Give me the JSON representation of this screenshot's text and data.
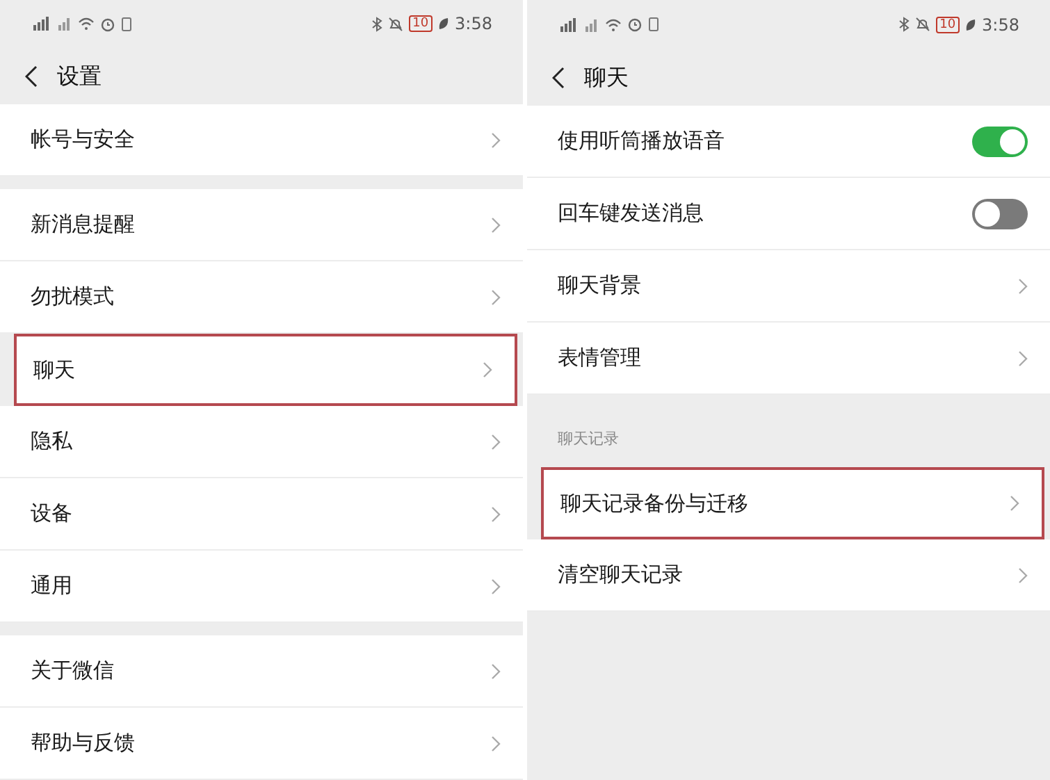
{
  "screens": [
    {
      "status_bar": {
        "battery": "10",
        "time": "3:58"
      },
      "title": "设置",
      "groups": [
        {
          "rows": [
            {
              "label": "帐号与安全",
              "kind": "link",
              "highlighted": false
            }
          ]
        },
        {
          "rows": [
            {
              "label": "新消息提醒",
              "kind": "link",
              "highlighted": false
            },
            {
              "label": "勿扰模式",
              "kind": "link",
              "highlighted": false
            },
            {
              "label": "聊天",
              "kind": "link",
              "highlighted": true
            },
            {
              "label": "隐私",
              "kind": "link",
              "highlighted": false
            },
            {
              "label": "设备",
              "kind": "link",
              "highlighted": false
            },
            {
              "label": "通用",
              "kind": "link",
              "highlighted": false
            }
          ]
        },
        {
          "rows": [
            {
              "label": "关于微信",
              "kind": "link",
              "highlighted": false
            },
            {
              "label": "帮助与反馈",
              "kind": "link",
              "highlighted": false
            }
          ]
        }
      ]
    },
    {
      "status_bar": {
        "battery": "10",
        "time": "3:58"
      },
      "title": "聊天",
      "groups": [
        {
          "rows": [
            {
              "label": "使用听筒播放语音",
              "kind": "toggle",
              "on": true,
              "highlighted": false
            },
            {
              "label": "回车键发送消息",
              "kind": "toggle",
              "on": false,
              "highlighted": false
            },
            {
              "label": "聊天背景",
              "kind": "link",
              "highlighted": false
            },
            {
              "label": "表情管理",
              "kind": "link",
              "highlighted": false
            }
          ]
        },
        {
          "header": "聊天记录",
          "rows": [
            {
              "label": "聊天记录备份与迁移",
              "kind": "link",
              "highlighted": true
            },
            {
              "label": "清空聊天记录",
              "kind": "link",
              "highlighted": false
            }
          ]
        }
      ]
    }
  ]
}
